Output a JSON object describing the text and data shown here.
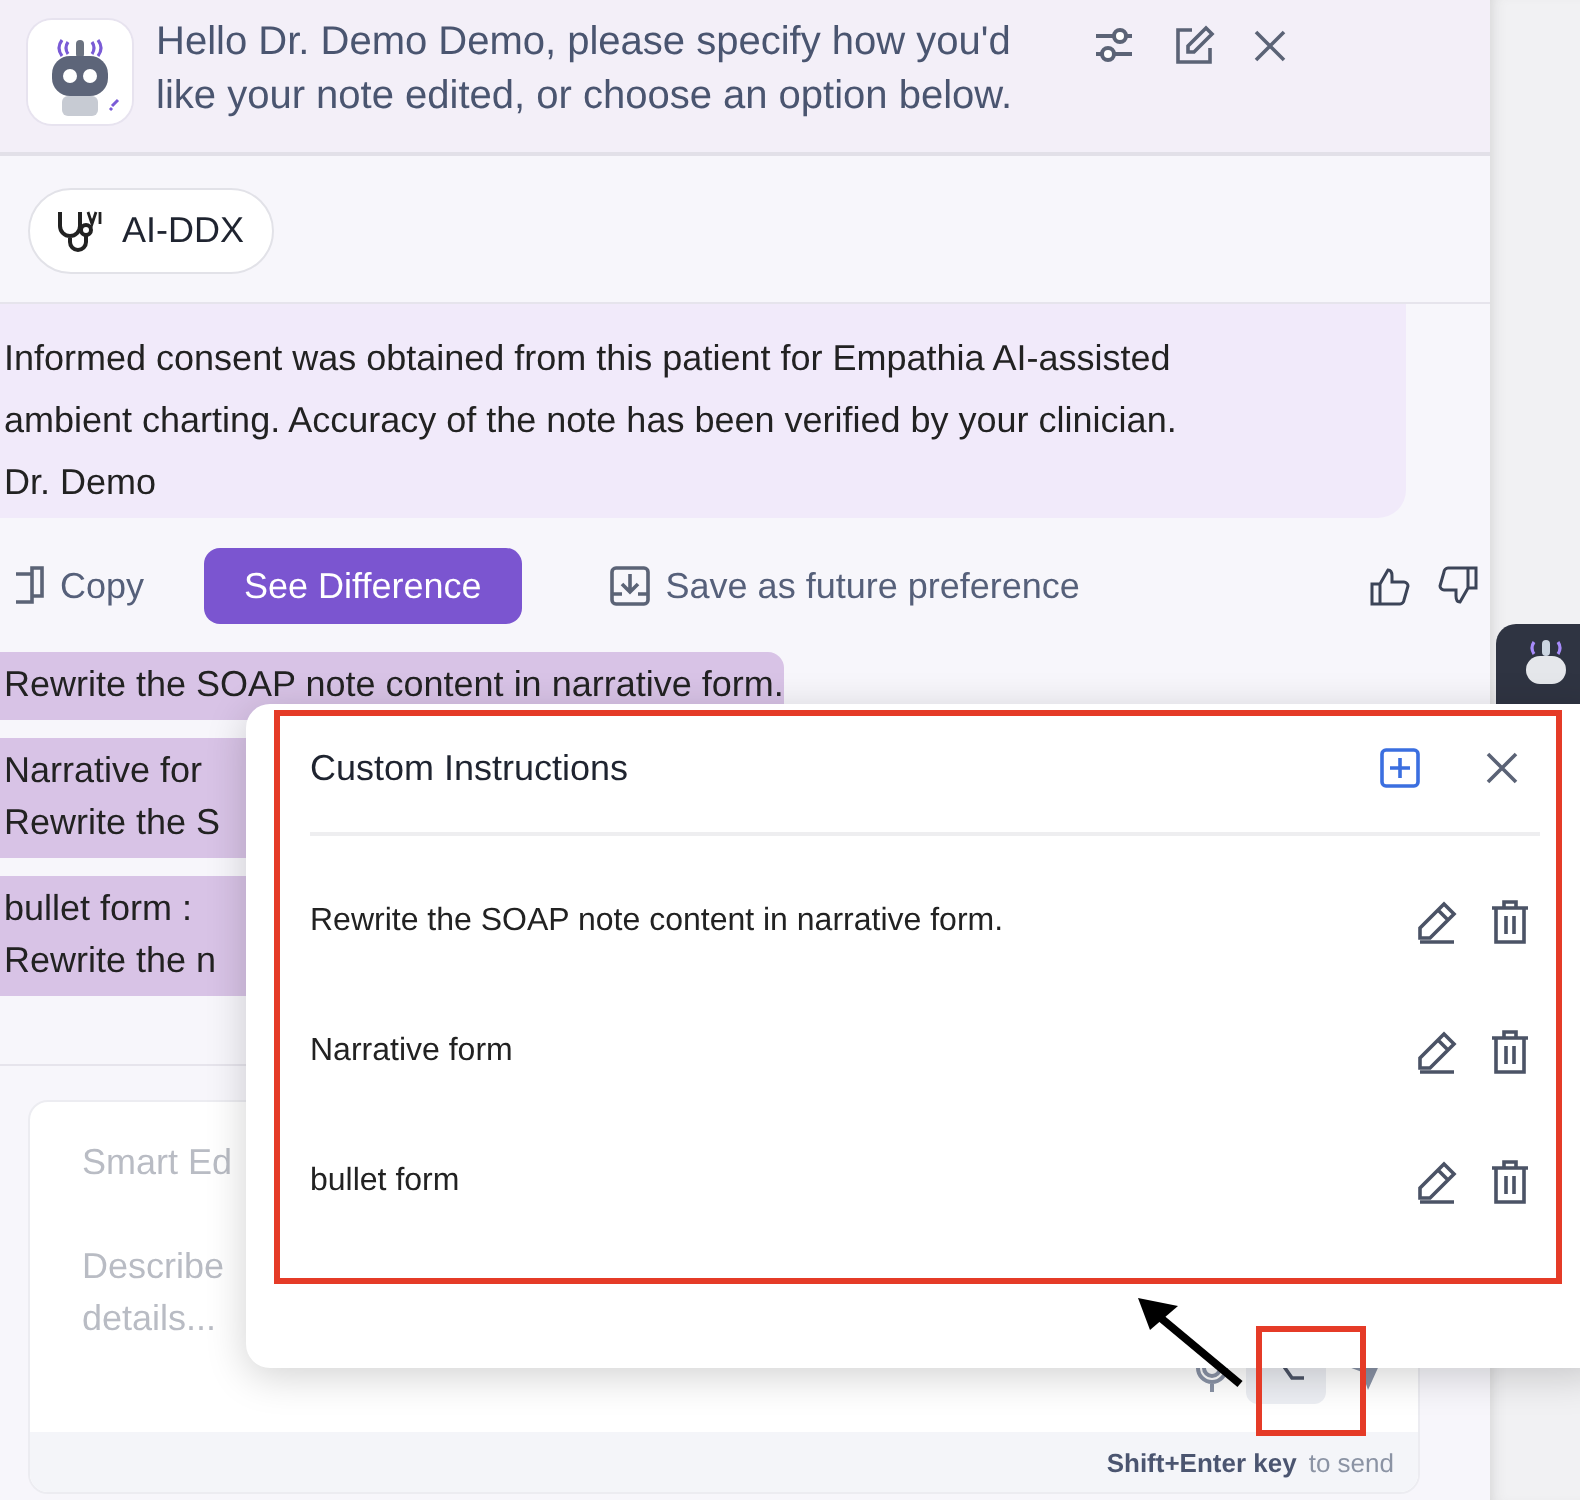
{
  "header": {
    "message": "Hello Dr. Demo Demo, please specify how you'd like your note edited, or choose an option below."
  },
  "chips": [
    {
      "label": "AI-DDX"
    }
  ],
  "note": {
    "lines": [
      "Informed consent was obtained from this patient for Empathia AI-assisted",
      "ambient charting. Accuracy of the note has been verified by your clinician.",
      "Dr. Demo"
    ]
  },
  "note_actions": {
    "copy": "Copy",
    "see_difference": "See Difference",
    "save": "Save as future preference"
  },
  "history": [
    {
      "lines": [
        "Rewrite the SOAP note content in narrative form."
      ]
    },
    {
      "lines": [
        "Narrative for",
        "Rewrite the S"
      ]
    },
    {
      "lines": [
        "bullet form :",
        "Rewrite the n"
      ]
    }
  ],
  "composer": {
    "title_placeholder": "Smart Ed",
    "placeholder_lines": [
      "Describe",
      "details..."
    ],
    "hint_keys": "Shift+Enter key",
    "hint_suffix": "to send"
  },
  "popup": {
    "title": "Custom Instructions",
    "items": [
      {
        "text": "Rewrite the SOAP note content in narrative form."
      },
      {
        "text": "Narrative form"
      },
      {
        "text": "bullet form"
      }
    ]
  }
}
